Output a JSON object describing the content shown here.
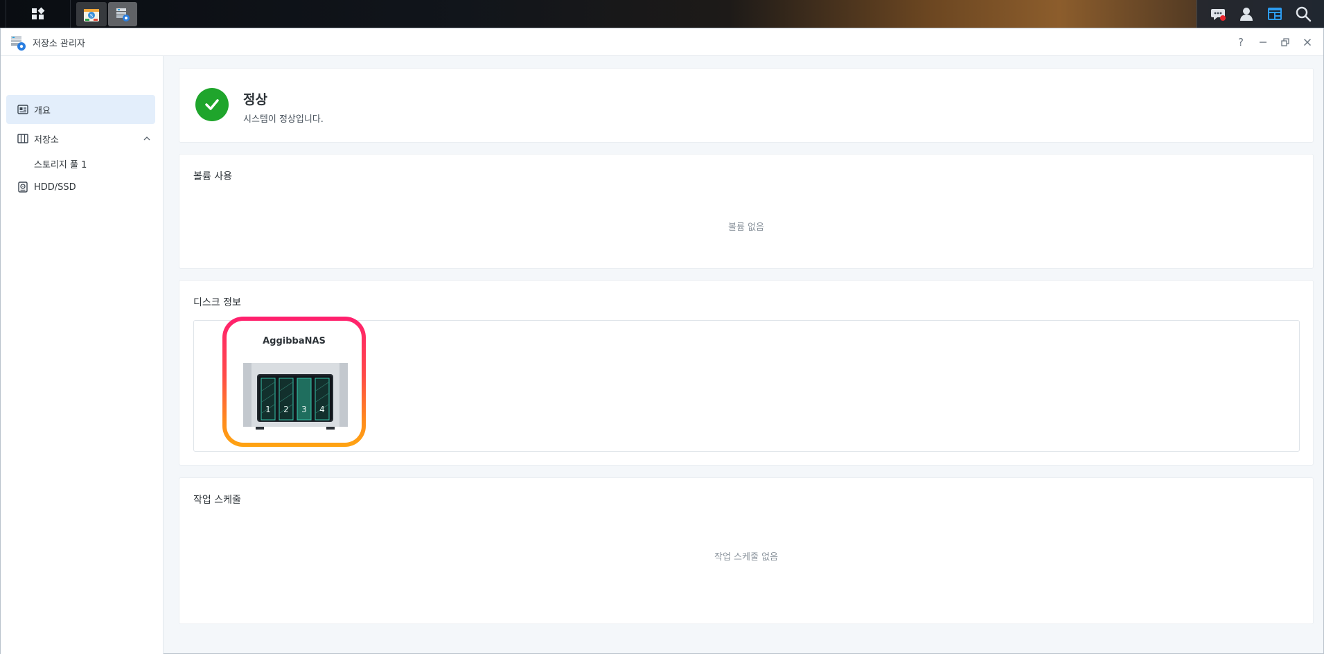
{
  "app": {
    "title": "저장소 관리자"
  },
  "window_controls": {
    "help": "?",
    "minimize": "−",
    "restore": "❐",
    "close": "✕"
  },
  "sidebar": {
    "items": [
      {
        "label": "개요",
        "icon": "overview-icon",
        "active": true
      },
      {
        "label": "저장소",
        "icon": "storage-icon",
        "expanded": true,
        "children": [
          {
            "label": "스토리지 풀 1"
          }
        ]
      },
      {
        "label": "HDD/SSD",
        "icon": "hdd-icon"
      }
    ]
  },
  "status": {
    "title": "정상",
    "message": "시스템이 정상입니다.",
    "color": "#1fa52c"
  },
  "volume_usage": {
    "title": "볼륨 사용",
    "empty": "볼륨 없음"
  },
  "disk_info": {
    "title": "디스크 정보",
    "device_name": "AggibbaNAS",
    "bays": [
      "1",
      "2",
      "3",
      "4"
    ],
    "highlight_gradient": [
      "#ff1f6e",
      "#ffa412"
    ]
  },
  "task_schedule": {
    "title": "작업 스케줄",
    "empty": "작업 스케줄 없음"
  },
  "taskbar": {
    "icons": [
      "main-menu-icon",
      "package-center-icon",
      "storage-manager-icon",
      "notification-icon",
      "user-icon",
      "widgets-icon",
      "search-icon"
    ]
  }
}
